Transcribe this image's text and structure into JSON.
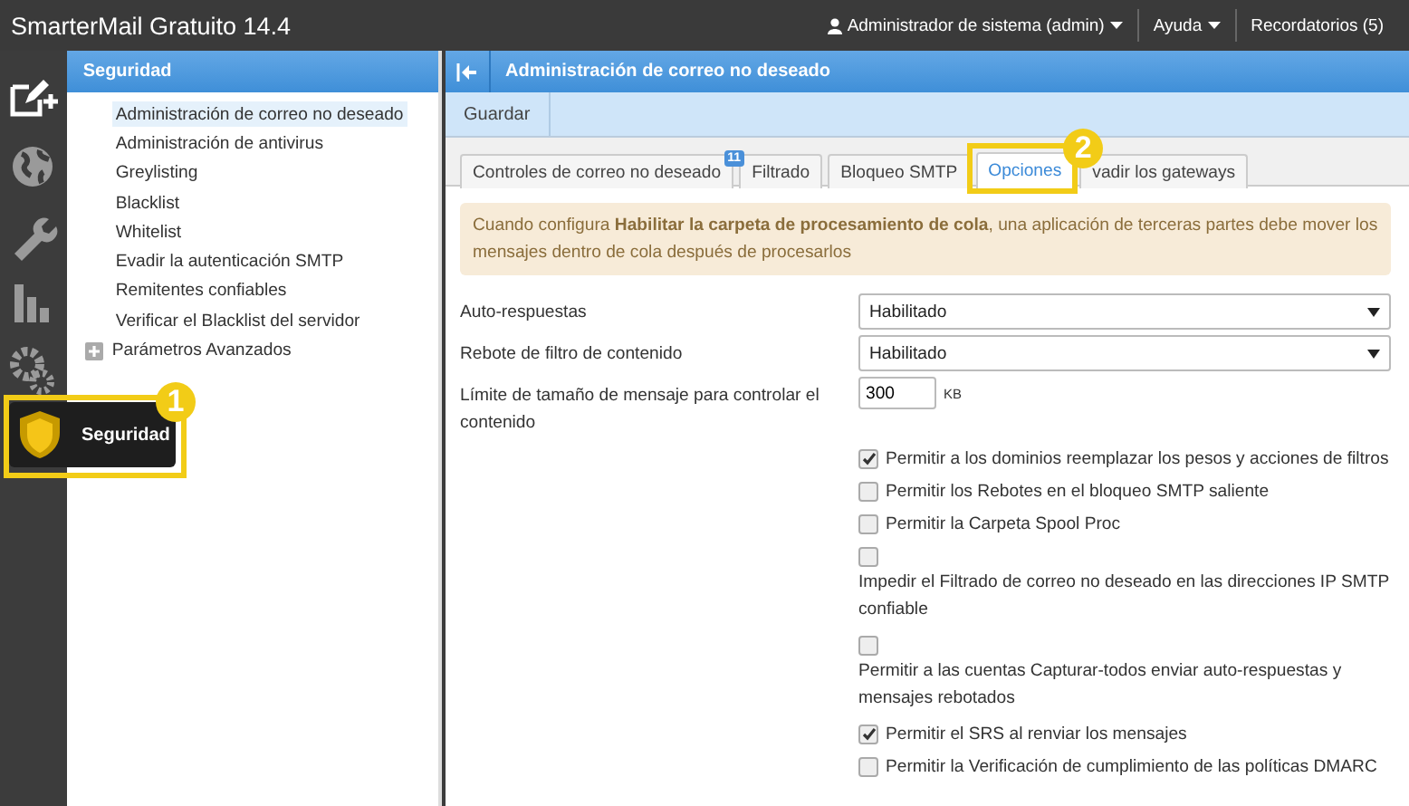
{
  "topbar": {
    "title": "SmarterMail Gratuito 14.4",
    "user": "Administrador de sistema (admin)",
    "help": "Ayuda",
    "reminders": "Recordatorios (5)"
  },
  "rail": {
    "items": [
      {
        "kind": "compose",
        "selected": false
      },
      {
        "kind": "globe",
        "selected": false
      },
      {
        "kind": "wrench",
        "selected": false
      },
      {
        "kind": "chart",
        "selected": false
      },
      {
        "kind": "gears",
        "selected": false
      }
    ],
    "flyout": {
      "label": "Seguridad",
      "callout": "1"
    }
  },
  "sidebar": {
    "title": "Seguridad",
    "items": [
      {
        "label": "Administración de correo no deseado",
        "selected": true
      },
      {
        "label": "Administración de antivirus",
        "selected": false
      },
      {
        "label": "Greylisting",
        "selected": false
      },
      {
        "label": "Blacklist",
        "selected": false
      },
      {
        "label": "Whitelist",
        "selected": false
      },
      {
        "label": "Evadir la autenticación SMTP",
        "selected": false
      },
      {
        "label": "Remitentes confiables",
        "selected": false
      },
      {
        "label": "Verificar el Blacklist del servidor",
        "selected": false
      },
      {
        "label": "Parámetros Avanzados",
        "selected": false,
        "expanded": false
      }
    ]
  },
  "main": {
    "title": "Administración de correo no deseado",
    "toolbar": [
      "Guardar"
    ],
    "tabs": [
      {
        "label": "Controles de correo no deseado",
        "selected": false,
        "badge": "11"
      },
      {
        "label": "Filtrado",
        "selected": false
      },
      {
        "label": "Bloqueo SMTP",
        "selected": false
      },
      {
        "label": "Opciones",
        "selected": true,
        "callout": "2"
      },
      {
        "label": "vadir los gateways",
        "selected": false
      }
    ],
    "notice": "Cuando configura **Habilitar la carpeta de procesamiento de cola**, una aplicación de terceras partes debe mover los mensajes dentro de cola después de procesarlos",
    "fields": [
      {
        "kind": "select",
        "label": "Auto-respuestas",
        "value": "Habilitado"
      },
      {
        "kind": "select",
        "label": "Rebote de filtro de contenido",
        "value": "Habilitado"
      },
      {
        "kind": "number",
        "label": "Límite de tamaño de mensaje para controlar el contenido",
        "value": "300",
        "unit": "KB"
      }
    ],
    "options": [
      {
        "kind": "inline",
        "label": "Permitir a los dominios reemplazar los pesos y acciones de filtros",
        "checked": true
      },
      {
        "kind": "inline",
        "label": "Permitir los Rebotes en el bloqueo SMTP saliente",
        "checked": false
      },
      {
        "kind": "inline",
        "label": "Permitir la Carpeta Spool Proc",
        "checked": false
      },
      {
        "kind": "stacked",
        "label": "Impedir el Filtrado de correo no deseado en las direcciones IP SMTP confiable",
        "checked": false
      },
      {
        "kind": "stacked",
        "label": "Permitir a las cuentas Capturar-todos enviar auto-respuestas y mensajes rebotados",
        "checked": false
      },
      {
        "kind": "inline",
        "label": "Permitir el SRS al renviar los mensajes",
        "checked": true
      },
      {
        "kind": "inline",
        "label": "Permitir la Verificación de cumplimiento de las políticas DMARC",
        "checked": false
      }
    ]
  }
}
